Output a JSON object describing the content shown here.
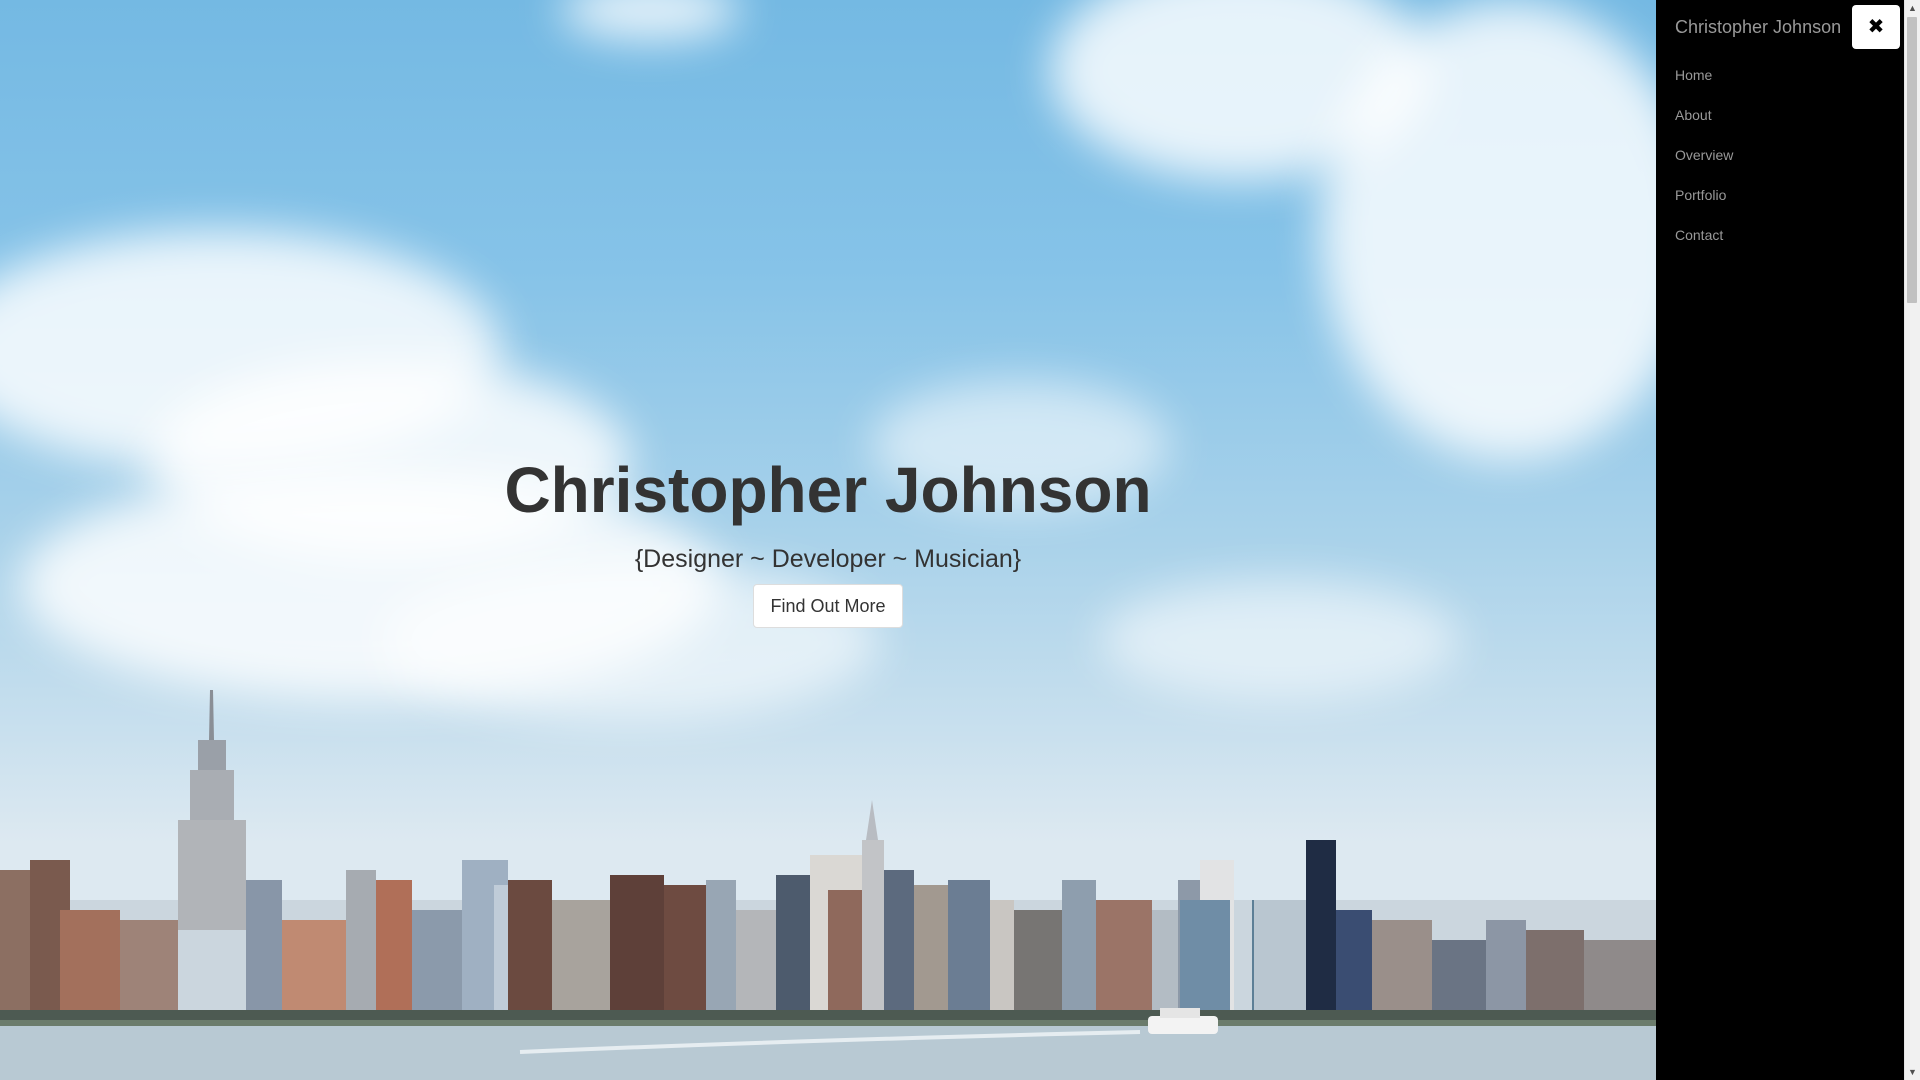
{
  "hero": {
    "title": "Christopher Johnson",
    "subtitle": "{Designer ~ Developer ~ Musician}",
    "cta_label": "Find Out More"
  },
  "sidebar": {
    "brand": "Christopher Johnson",
    "close_icon": "close-icon",
    "items": [
      {
        "label": "Home"
      },
      {
        "label": "About"
      },
      {
        "label": "Overview"
      },
      {
        "label": "Portfolio"
      },
      {
        "label": "Contact"
      }
    ]
  },
  "colors": {
    "sidebar_bg": "#000000",
    "sidebar_text": "#999999",
    "hero_text": "#333333",
    "button_bg": "#ffffff"
  },
  "scrollbar": {
    "up_icon": "scroll-up-icon",
    "down_icon": "scroll-down-icon"
  }
}
